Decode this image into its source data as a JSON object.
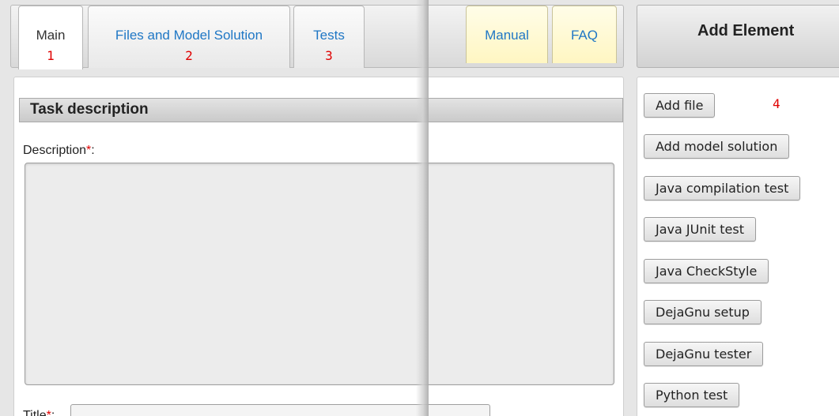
{
  "tabs": [
    {
      "label": "Main",
      "marker": "1"
    },
    {
      "label": "Files and Model Solution",
      "marker": "2"
    },
    {
      "label": "Tests",
      "marker": "3"
    },
    {
      "label": "Manual"
    },
    {
      "label": "FAQ"
    }
  ],
  "section": {
    "title": "Task description"
  },
  "fields": {
    "description_label": "Description",
    "title_label": "Title",
    "required_mark": "*",
    "colon": ":"
  },
  "right_panel": {
    "header": "Add Element",
    "marker": "4",
    "buttons": [
      "Add file",
      "Add model solution",
      "Java compilation test",
      "Java JUnit test",
      "Java CheckStyle",
      "DejaGnu setup",
      "DejaGnu tester",
      "Python test"
    ]
  },
  "colors": {
    "link": "#1f77c5",
    "required": "#e00000",
    "marker": "#e00000"
  }
}
